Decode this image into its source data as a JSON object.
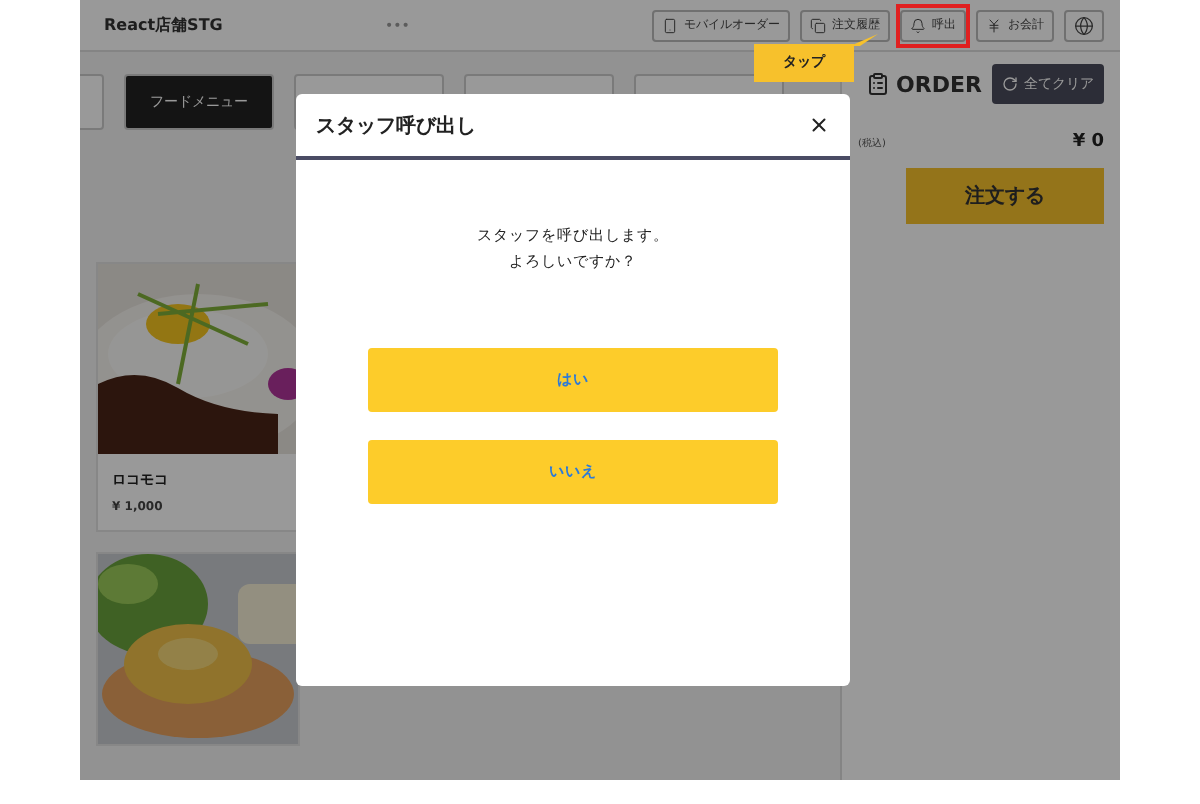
{
  "app": {
    "title": "React店舗STG",
    "menu_dots": "•••"
  },
  "header_buttons": [
    {
      "kind": "mobile",
      "label": "モバイルオーダー",
      "highlighted": false
    },
    {
      "kind": "history",
      "label": "注文履歴",
      "highlighted": false
    },
    {
      "kind": "bell",
      "label": "呼出",
      "highlighted": true
    },
    {
      "kind": "yen",
      "label": "お会計",
      "highlighted": false
    },
    {
      "kind": "globe",
      "highlighted": false
    }
  ],
  "tooltip": {
    "label": "タップ"
  },
  "categories": [
    {
      "selected": false
    },
    {
      "label": "フードメニュー",
      "selected": true
    },
    {
      "selected": false
    },
    {
      "selected": false
    },
    {
      "selected": false
    }
  ],
  "menu_items": [
    {
      "kind": "picture",
      "name": "ロコモコ",
      "price": "¥ 1,000"
    },
    {
      "kind": "picture"
    }
  ],
  "order": {
    "title": "ORDER",
    "clear_label": "全てクリア",
    "total_label": "(税込)",
    "total": "¥ 0",
    "submit": "注文する"
  },
  "dialog": {
    "title": "スタッフ呼び出し",
    "message_lines": [
      "スタッフを呼び出します。",
      "よろしいですか？"
    ],
    "buttons": [
      "はい",
      "いいえ"
    ]
  }
}
